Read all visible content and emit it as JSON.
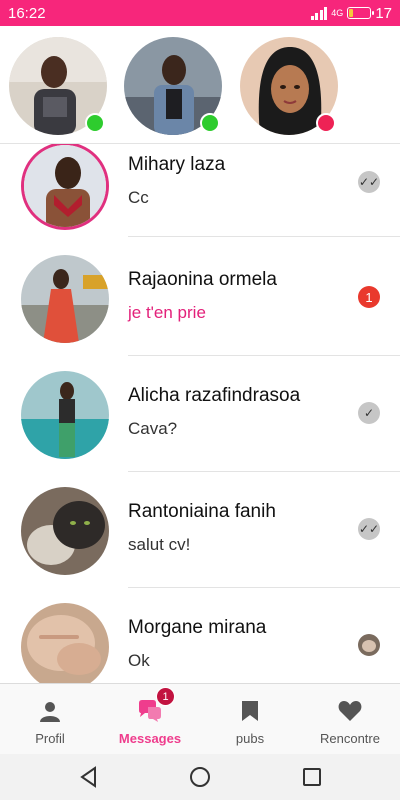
{
  "status_bar": {
    "time": "16:22",
    "network": "4G",
    "battery": "17",
    "battery_level": 0.17,
    "color": "#f7267b"
  },
  "stories": [
    {
      "avatar": "avatar-story-1",
      "online": true,
      "status_color": "#2ecc2e"
    },
    {
      "avatar": "avatar-story-2",
      "online": true,
      "status_color": "#2ecc2e"
    },
    {
      "avatar": "avatar-story-3",
      "online": false,
      "status_color": "#ee2255"
    }
  ],
  "conversations": [
    {
      "name": "Mihary laza",
      "message": "Cc",
      "status": "read",
      "status_icon": "double-check-icon"
    },
    {
      "name": "Rajaonina ormela",
      "message": "je t'en prie",
      "status": "unread",
      "unread_count": "1"
    },
    {
      "name": "Alicha razafindrasoa",
      "message": "Cava?",
      "status": "sent",
      "status_icon": "check-icon"
    },
    {
      "name": "Rantoniaina fanih",
      "message": "salut cv!",
      "status": "read",
      "status_icon": "double-check-icon"
    },
    {
      "name": "Morgane mirana",
      "message": "Ok",
      "status": "seen-avatar"
    }
  ],
  "bottom_nav": {
    "items": [
      {
        "label": "Profil",
        "icon": "person-icon"
      },
      {
        "label": "Messages",
        "icon": "chat-bubbles-icon",
        "badge": "1",
        "active": true
      },
      {
        "label": "pubs",
        "icon": "bookmark-icon"
      },
      {
        "label": "Rencontre",
        "icon": "heart-icon"
      }
    ],
    "active_color": "#ef3d8d"
  },
  "system_nav": {
    "buttons": [
      "back-icon",
      "home-icon",
      "recents-icon"
    ]
  }
}
